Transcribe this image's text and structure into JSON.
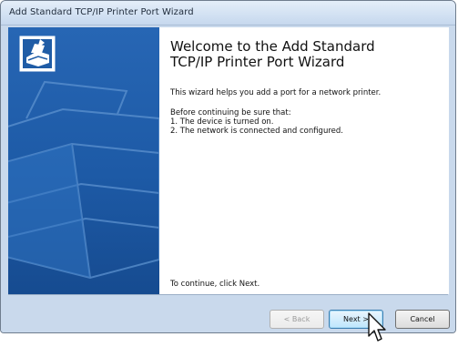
{
  "window": {
    "title": "Add Standard TCP/IP Printer Port Wizard"
  },
  "main": {
    "heading_line1": "Welcome to the Add Standard",
    "heading_line2": "TCP/IP Printer Port Wizard",
    "intro": "This wizard helps you add a port for a network printer.",
    "before_label": "Before continuing be sure that:",
    "checklist": [
      "1.  The device is turned on.",
      "2.  The network is connected and configured."
    ],
    "footer": "To continue, click Next."
  },
  "buttons": {
    "back": "< Back",
    "next": "Next >",
    "cancel": "Cancel"
  },
  "icons": {
    "wizard": "printer-wizard-icon",
    "cursor": "mouse-cursor-icon"
  },
  "colors": {
    "sidebar": "#1d5aa6",
    "dialog_bg": "#c9d9ec"
  }
}
